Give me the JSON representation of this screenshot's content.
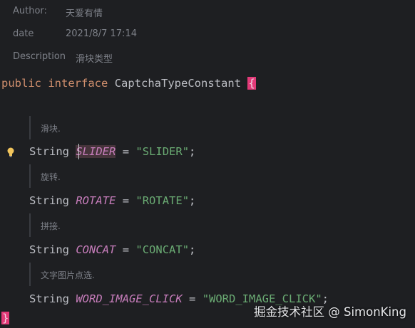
{
  "javadoc": {
    "author_label": "Author:",
    "author_value": "天爱有情",
    "date_label": "date",
    "date_value": "2021/8/7 17:14",
    "description_label": "Description",
    "description_value": "滑块类型"
  },
  "code": {
    "kw_public": "public",
    "kw_interface": "interface",
    "class_name": "CaptchaTypeConstant",
    "open_brace": "{",
    "close_brace": "}",
    "type_string": "String",
    "equals": "=",
    "semicolon": ";"
  },
  "fields": [
    {
      "doc": "滑块.",
      "name": "SLIDER",
      "value": "\"SLIDER\""
    },
    {
      "doc": "旋转.",
      "name": "ROTATE",
      "value": "\"ROTATE\""
    },
    {
      "doc": "拼接.",
      "name": "CONCAT",
      "value": "\"CONCAT\""
    },
    {
      "doc": "文字图片点选.",
      "name": "WORD_IMAGE_CLICK",
      "value": "\"WORD_IMAGE_CLICK\""
    }
  ],
  "gutter": {
    "intention_icon": "lightbulb-icon"
  },
  "watermark": "掘金技术社区 @ SimonKing",
  "colors": {
    "background": "#1e1f22",
    "keyword": "#cf8e6d",
    "constant": "#c77dbb",
    "string": "#6aab73",
    "brace_highlight": "#e23a78",
    "doc_text": "#7d8088"
  }
}
